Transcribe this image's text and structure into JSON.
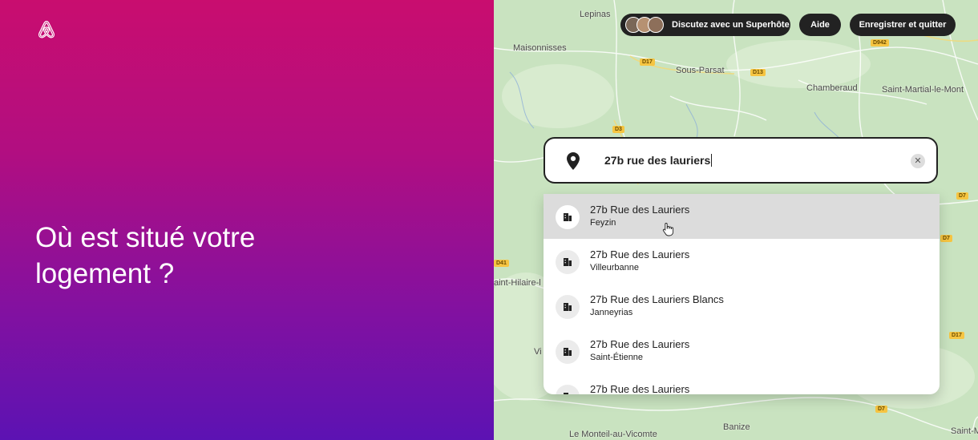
{
  "headline": "Où est situé votre logement ?",
  "header": {
    "superhost_label": "Discutez avec un Superhôte",
    "help_label": "Aide",
    "save_exit_label": "Enregistrer et quitter"
  },
  "search": {
    "value": "27b rue des lauriers",
    "clear_icon": "close-icon",
    "pin_icon": "location-pin-icon"
  },
  "suggestions": [
    {
      "title": "27b Rue des Lauriers",
      "subtitle": "Feyzin",
      "highlighted": true
    },
    {
      "title": "27b Rue des Lauriers",
      "subtitle": "Villeurbanne"
    },
    {
      "title": "27b Rue des Lauriers Blancs",
      "subtitle": "Janneyrias"
    },
    {
      "title": "27b Rue des Lauriers",
      "subtitle": "Saint-Étienne"
    },
    {
      "title": "27b Rue des Lauriers",
      "subtitle": ""
    }
  ],
  "map": {
    "places": [
      "Lepinas",
      "Maisonnisses",
      "Sous-Parsat",
      "Chamberaud",
      "Saint-Martial-le-Mont",
      "aint-Hilaire-l",
      "Vi",
      "Banize",
      "Le Monteil-au-Vicomte",
      "Saint-Mar"
    ],
    "roads": [
      "D942",
      "D17",
      "D13",
      "D3",
      "D7",
      "D7",
      "D7",
      "D17",
      "D41",
      "D7"
    ]
  },
  "colors": {
    "gradient_top": "#c90d6f",
    "gradient_bottom": "#5c12b3",
    "map_bg": "#c7e2bd",
    "pill_bg": "#222222",
    "highlight_row": "#dcdcdc"
  }
}
